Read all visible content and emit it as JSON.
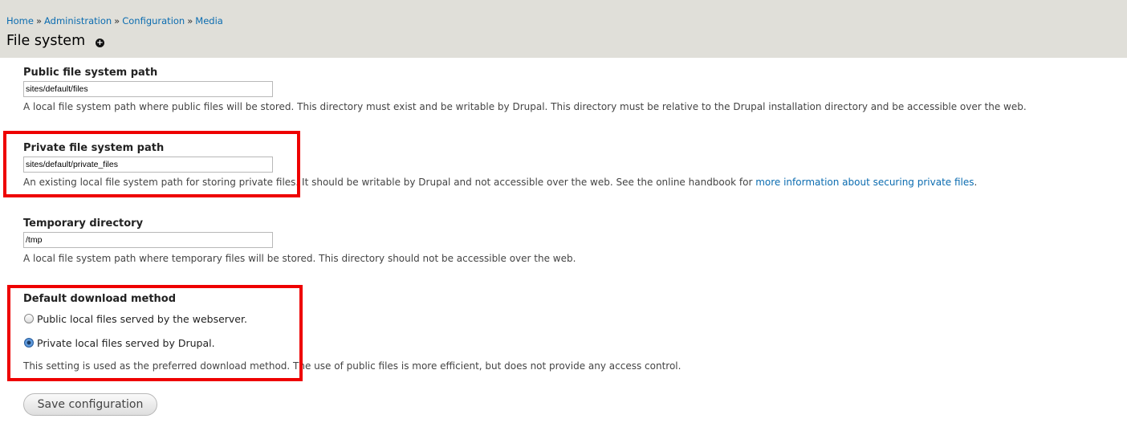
{
  "breadcrumb": {
    "items": [
      "Home",
      "Administration",
      "Configuration",
      "Media"
    ],
    "separator": "»"
  },
  "page": {
    "title": "File system",
    "shortcut_icon": "plus-icon"
  },
  "fields": {
    "public_path": {
      "label": "Public file system path",
      "value": "sites/default/files",
      "description": "A local file system path where public files will be stored. This directory must exist and be writable by Drupal. This directory must be relative to the Drupal installation directory and be accessible over the web."
    },
    "private_path": {
      "label": "Private file system path",
      "value": "sites/default/private_files",
      "description_prefix": "An existing local file system path for storing private files. It should be writable by Drupal and not accessible over the web. See the online handbook for ",
      "description_link": "more information about securing private files",
      "description_suffix": "."
    },
    "temporary_directory": {
      "label": "Temporary directory",
      "value": "/tmp",
      "description": "A local file system path where temporary files will be stored. This directory should not be accessible over the web."
    },
    "download_method": {
      "label": "Default download method",
      "options": [
        {
          "label": "Public local files served by the webserver.",
          "checked": false
        },
        {
          "label": "Private local files served by Drupal.",
          "checked": true
        }
      ],
      "description": "This setting is used as the preferred download method. The use of public files is more efficient, but does not provide any access control."
    }
  },
  "actions": {
    "save_label": "Save configuration"
  },
  "colors": {
    "header_bg": "#e0dfd9",
    "link": "#0b6cb0",
    "highlight": "#ee0000"
  }
}
